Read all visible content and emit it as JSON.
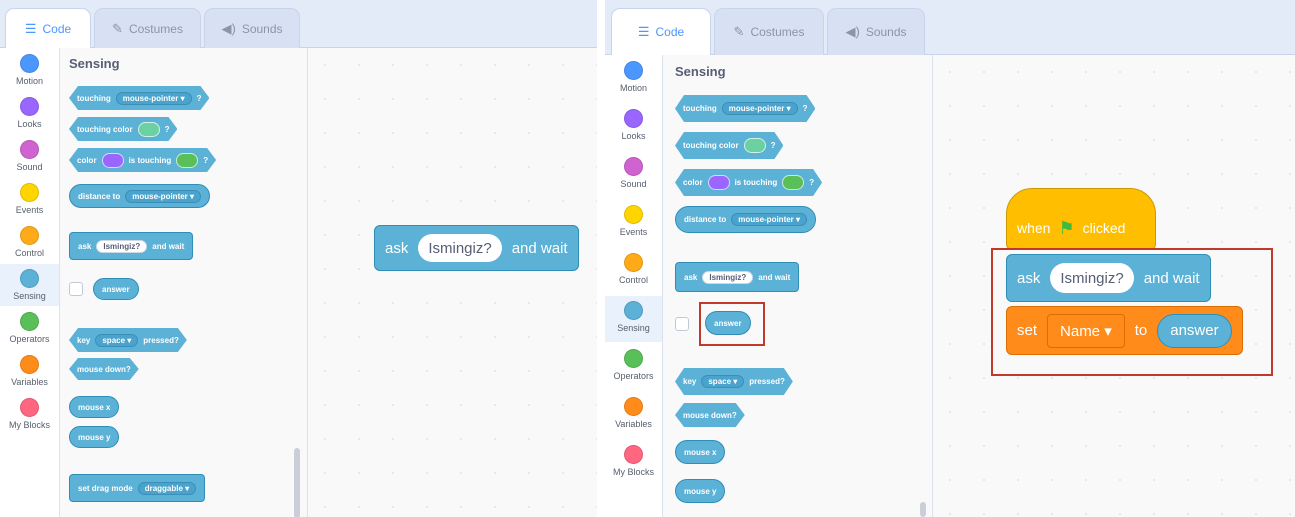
{
  "tabs": {
    "code": "Code",
    "costumes": "Costumes",
    "sounds": "Sounds"
  },
  "categories": [
    {
      "label": "Motion",
      "color": "#4c97ff"
    },
    {
      "label": "Looks",
      "color": "#9966ff"
    },
    {
      "label": "Sound",
      "color": "#cf63cf"
    },
    {
      "label": "Events",
      "color": "#ffd500"
    },
    {
      "label": "Control",
      "color": "#ffab19"
    },
    {
      "label": "Sensing",
      "color": "#5cb1d6"
    },
    {
      "label": "Operators",
      "color": "#59c059"
    },
    {
      "label": "Variables",
      "color": "#ff8c1a"
    },
    {
      "label": "My Blocks",
      "color": "#ff6680"
    }
  ],
  "palette": {
    "title": "Sensing",
    "touching": {
      "label": "touching",
      "menu": "mouse-pointer ▾",
      "tail": "?"
    },
    "touching_color": {
      "label": "touching color",
      "tail": "?",
      "swatch": "#6bd1a2"
    },
    "color_touching": {
      "label1": "color",
      "label2": "is touching",
      "tail": "?",
      "swatch1": "#9966ff",
      "swatch2": "#59c059"
    },
    "distance": {
      "label": "distance to",
      "menu": "mouse-pointer ▾"
    },
    "ask": {
      "label": "ask",
      "input": "Ismingiz?",
      "tail": "and wait"
    },
    "answer": "answer",
    "key_pressed": {
      "label": "key",
      "menu": "space ▾",
      "tail": "pressed?"
    },
    "mouse_down": "mouse down?",
    "mouse_x": "mouse x",
    "mouse_y": "mouse y",
    "drag_mode": {
      "label": "set drag mode",
      "menu": "draggable ▾"
    }
  },
  "workspace_left": {
    "ask": {
      "label": "ask",
      "input": "Ismingiz?",
      "tail": "and wait"
    }
  },
  "workspace_right": {
    "hat": {
      "label1": "when",
      "label2": "clicked"
    },
    "ask": {
      "label": "ask",
      "input": "Ismingiz?",
      "tail": "and wait"
    },
    "set": {
      "label": "set",
      "menu": "Name ▾",
      "to": "to",
      "value": "answer"
    }
  },
  "colors": {
    "sensing": "#5cb1d6",
    "events": "#ffbf00",
    "variables": "#ff8c1a",
    "highlight": "#c0392b"
  }
}
